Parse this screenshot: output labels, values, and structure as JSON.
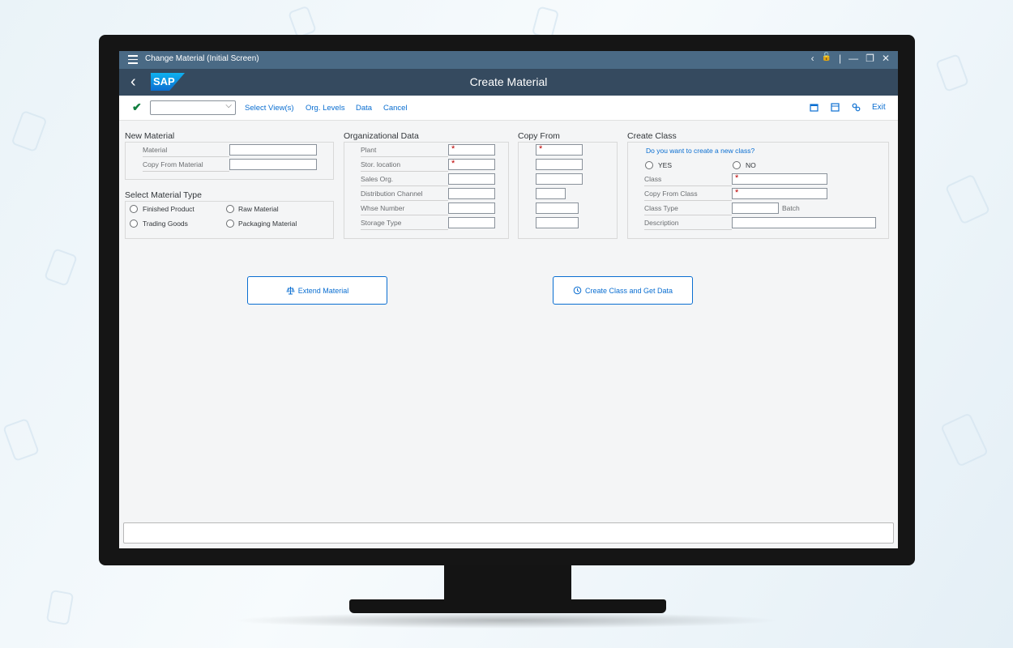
{
  "window": {
    "title": "Change Material (Initial Screen)",
    "controls": [
      "‹",
      "🔓",
      "|",
      "—",
      "❐",
      "✕"
    ]
  },
  "shell": {
    "logo": "SAP",
    "app_title": "Create Material"
  },
  "toolbar": {
    "links": [
      "Select View(s)",
      "Org. Levels",
      "Data",
      "Cancel"
    ],
    "exit": "Exit"
  },
  "new_material": {
    "title": "New Material",
    "fields": [
      {
        "label": "Material",
        "value": ""
      },
      {
        "label": "Copy From Material",
        "value": ""
      }
    ]
  },
  "material_type": {
    "title": "Select Material Type",
    "options": [
      "Finished Product",
      "Raw Material",
      "Trading Goods",
      "Packaging Material"
    ]
  },
  "org_data": {
    "title": "Organizational Data",
    "fields": [
      {
        "label": "Plant",
        "required": true
      },
      {
        "label": "Stor. location",
        "required": true
      },
      {
        "label": "Sales Org.",
        "required": false
      },
      {
        "label": "Distribution Channel",
        "required": false
      },
      {
        "label": "Whse Number",
        "required": false
      },
      {
        "label": "Storage Type",
        "required": false
      }
    ]
  },
  "copy_from": {
    "title": "Copy From",
    "required_marker": "*"
  },
  "create_class": {
    "title": "Create Class",
    "question": "Do you want to create a new class?",
    "yes": "YES",
    "no": "NO",
    "fields": [
      {
        "label": "Class",
        "required": true
      },
      {
        "label": "Copy From Class",
        "required": true
      },
      {
        "label": "Class Type",
        "suffix": "Batch"
      },
      {
        "label": "Description"
      }
    ]
  },
  "buttons": {
    "extend": "Extend Material",
    "create_class": "Create Class and Get Data"
  }
}
